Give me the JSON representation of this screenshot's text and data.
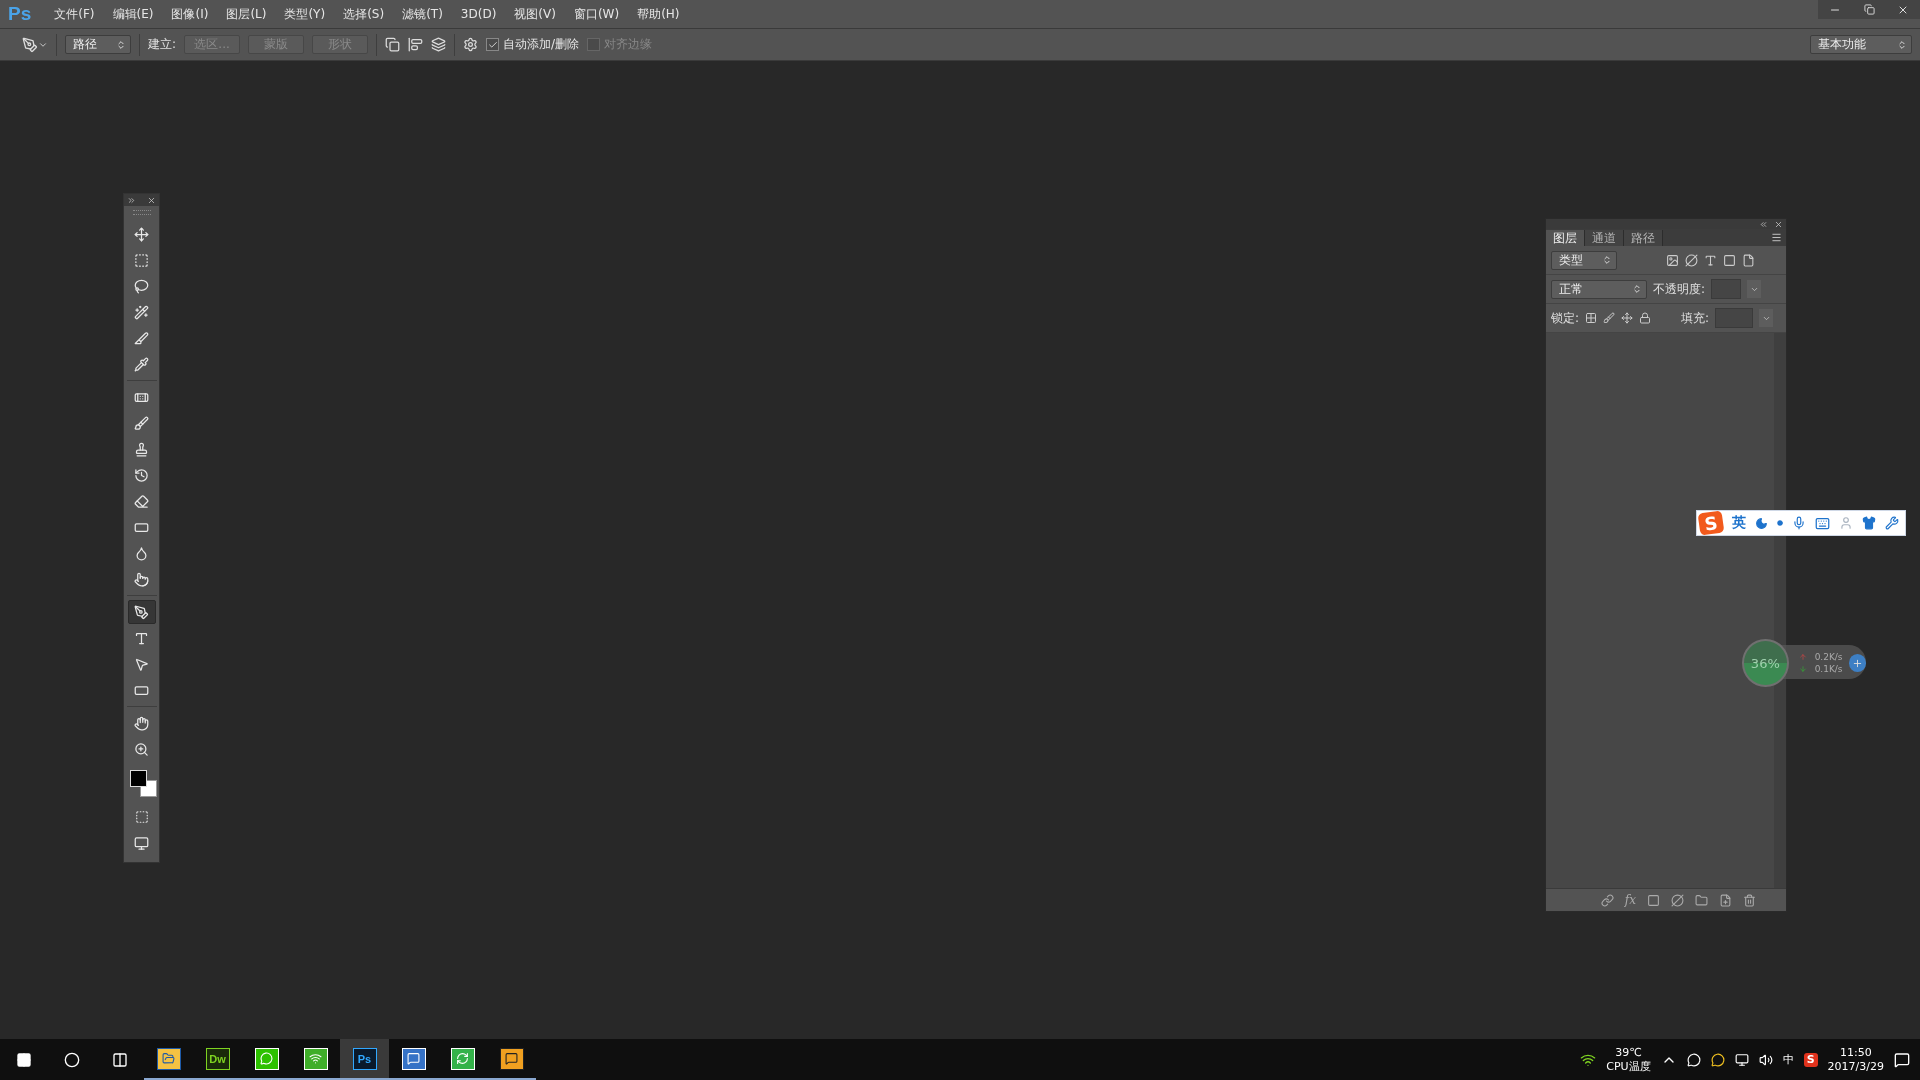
{
  "app": {
    "logo": "Ps",
    "menu": [
      "文件(F)",
      "编辑(E)",
      "图像(I)",
      "图层(L)",
      "类型(Y)",
      "选择(S)",
      "滤镜(T)",
      "3D(D)",
      "视图(V)",
      "窗口(W)",
      "帮助(H)"
    ]
  },
  "options_bar": {
    "preset": "路径",
    "make_label": "建立:",
    "make_buttons": [
      {
        "label": "选区...",
        "disabled": true
      },
      {
        "label": "蒙版",
        "disabled": true
      },
      {
        "label": "形状",
        "disabled": true
      }
    ],
    "checkboxes": [
      {
        "label": "自动添加/删除",
        "checked": true,
        "disabled": false
      },
      {
        "label": "对齐边缘",
        "checked": false,
        "disabled": true
      }
    ],
    "workspace": "基本功能"
  },
  "tool_groups": [
    {
      "tools": [
        {
          "selected": false
        },
        {
          "selected": false
        },
        {
          "selected": false
        },
        {
          "selected": false
        },
        {
          "selected": false
        },
        {
          "selected": false
        }
      ]
    },
    {
      "tools": [
        {
          "selected": false
        },
        {
          "selected": false
        },
        {
          "selected": false
        },
        {
          "selected": false
        },
        {
          "selected": false
        },
        {
          "selected": false
        },
        {
          "selected": false
        },
        {
          "selected": false
        }
      ]
    },
    {
      "tools": [
        {
          "selected": true
        },
        {
          "selected": false
        },
        {
          "selected": false
        },
        {
          "selected": false
        }
      ]
    },
    {
      "tools": [
        {
          "selected": false
        },
        {
          "selected": false
        }
      ]
    }
  ],
  "layers_panel": {
    "tabs": [
      {
        "label": "图层",
        "selected": true
      },
      {
        "label": "通道",
        "selected": false
      },
      {
        "label": "路径",
        "selected": false
      }
    ],
    "filter": "类型",
    "blend_mode": "正常",
    "opacity_label": "不透明度:",
    "lock_label": "锁定:",
    "fill_label": "填充:",
    "fx": "fx"
  },
  "ime_bar": {
    "logo": "S",
    "mode": "英"
  },
  "net_widget": {
    "cpu": "36%",
    "up": "0.2K/s",
    "down": "0.1K/s"
  },
  "taskbar": {
    "apps": [
      {
        "selected": false
      },
      {
        "label": "Dw",
        "selected": false
      },
      {
        "selected": false
      },
      {
        "selected": false
      },
      {
        "label": "Ps",
        "selected": true
      },
      {
        "selected": false
      },
      {
        "selected": false
      },
      {
        "selected": false
      }
    ],
    "temp": "39℃",
    "temp_label": "CPU温度",
    "ime": "中",
    "tray_logo": "S",
    "time": "11:50",
    "date": "2017/3/29"
  }
}
